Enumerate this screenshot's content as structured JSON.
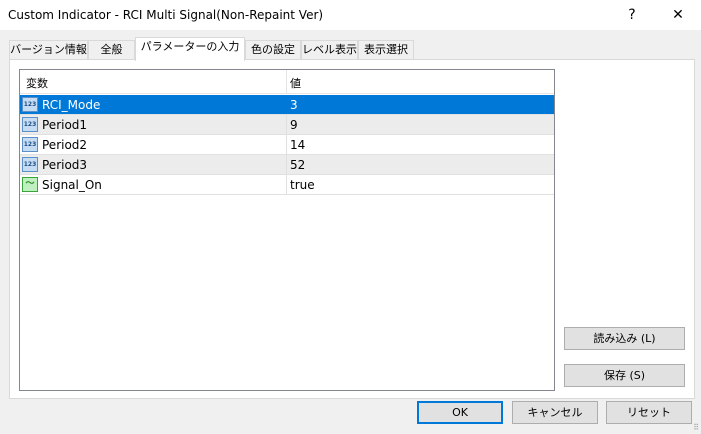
{
  "window": {
    "title": "Custom Indicator - RCI Multi Signal(Non-Repaint Ver)",
    "help": "?",
    "close": "✕"
  },
  "tabs": [
    "バージョン情報",
    "全般",
    "パラメーターの入力",
    "色の設定",
    "レベル表示",
    "表示選択"
  ],
  "table": {
    "headers": [
      "変数",
      "値"
    ],
    "rows": [
      {
        "icon": "123",
        "name": "RCI_Mode",
        "value": "3"
      },
      {
        "icon": "123",
        "name": "Period1",
        "value": "9"
      },
      {
        "icon": "123",
        "name": "Period2",
        "value": "14"
      },
      {
        "icon": "123",
        "name": "Period3",
        "value": "52"
      },
      {
        "icon": "～",
        "name": "Signal_On",
        "value": "true"
      }
    ]
  },
  "side_buttons": {
    "load": "読み込み (L)",
    "save": "保存 (S)"
  },
  "footer": {
    "ok": "OK",
    "cancel": "キャンセル",
    "reset": "リセット"
  },
  "colors": {
    "selection": "#0078d7"
  }
}
